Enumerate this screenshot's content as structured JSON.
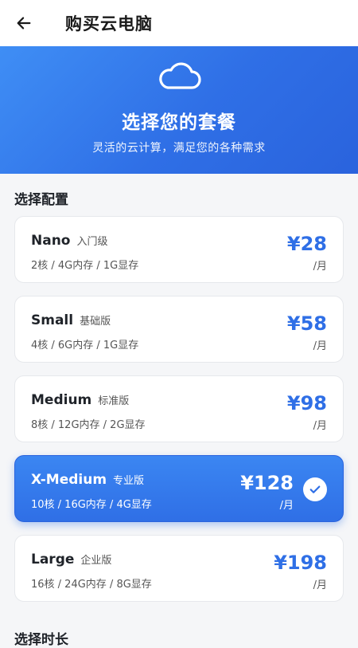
{
  "header": {
    "title": "购买云电脑"
  },
  "hero": {
    "headline": "选择您的套餐",
    "subtitle": "灵活的云计算，满足您的各种需求",
    "icon": "cloud-icon"
  },
  "config": {
    "section_title": "选择配置",
    "plans": [
      {
        "name": "Nano",
        "tier": "入门级",
        "spec": "2核 / 4G内存 / 1G显存",
        "price": "¥28",
        "unit": "/月",
        "selected": false
      },
      {
        "name": "Small",
        "tier": "基础版",
        "spec": "4核 / 6G内存 / 1G显存",
        "price": "¥58",
        "unit": "/月",
        "selected": false
      },
      {
        "name": "Medium",
        "tier": "标准版",
        "spec": "8核 / 12G内存 / 2G显存",
        "price": "¥98",
        "unit": "/月",
        "selected": false
      },
      {
        "name": "X-Medium",
        "tier": "专业版",
        "spec": "10核 / 16G内存 / 4G显存",
        "price": "¥128",
        "unit": "/月",
        "selected": true
      },
      {
        "name": "Large",
        "tier": "企业版",
        "spec": "16核 / 24G内存 / 8G显存",
        "price": "¥198",
        "unit": "/月",
        "selected": false
      }
    ]
  },
  "next_section": {
    "title": "选择时长"
  },
  "colors": {
    "accent": "#2f6fe6",
    "background": "#f5f6f8"
  }
}
